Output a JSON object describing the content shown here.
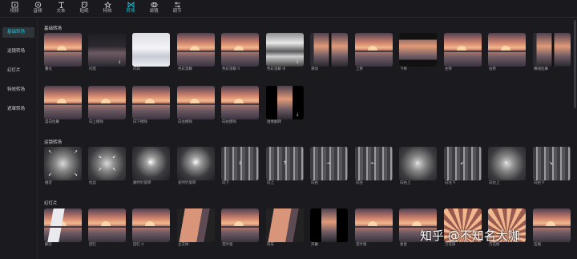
{
  "toolbar": {
    "items": [
      {
        "label": "视频",
        "icon": "video-icon"
      },
      {
        "label": "音频",
        "icon": "audio-icon"
      },
      {
        "label": "文本",
        "icon": "text-icon"
      },
      {
        "label": "贴纸",
        "icon": "sticker-icon"
      },
      {
        "label": "特效",
        "icon": "effects-icon"
      },
      {
        "label": "转场",
        "icon": "transition-icon",
        "active": true
      },
      {
        "label": "滤镜",
        "icon": "filter-icon"
      },
      {
        "label": "调节",
        "icon": "adjust-icon"
      }
    ]
  },
  "sidebar": {
    "items": [
      {
        "label": "基础转场",
        "active": true
      },
      {
        "label": "运镜转场"
      },
      {
        "label": "幻灯片"
      },
      {
        "label": "特效转场"
      },
      {
        "label": "遮罩转场"
      }
    ]
  },
  "sections": {
    "basic": {
      "title": "基础转场",
      "row1": [
        "叠化",
        "闪黑",
        "闪白",
        "色彩溶解",
        "色彩溶解 II",
        "色彩溶解 III",
        "滑动",
        "上移",
        "下移",
        "左移",
        "右移",
        "横线拉幕"
      ],
      "row2": [
        "竖向拉幕",
        "向上擦除",
        "向下擦除",
        "向左擦除",
        "向右擦除",
        "镜像翻转"
      ]
    },
    "camera": {
      "title": "运镜转场",
      "items": [
        "推近",
        "拉远",
        "顺时针旋转",
        "逆时针旋转",
        "向下",
        "向上",
        "向右",
        "向左",
        "向右上",
        "向左下",
        "向左上",
        "向右下"
      ]
    },
    "slides": {
      "title": "幻灯片",
      "items": [
        "翻页",
        "回忆",
        "回忆 II",
        "立方体",
        "百叶窗",
        "风车",
        "开幕",
        "百叶窗",
        "星星",
        "万花筒",
        "万花筒",
        "压缩"
      ]
    }
  },
  "watermark": "知乎 @不知名大咖",
  "colors": {
    "accent": "#25c2d6",
    "background": "#1b1b1f"
  }
}
